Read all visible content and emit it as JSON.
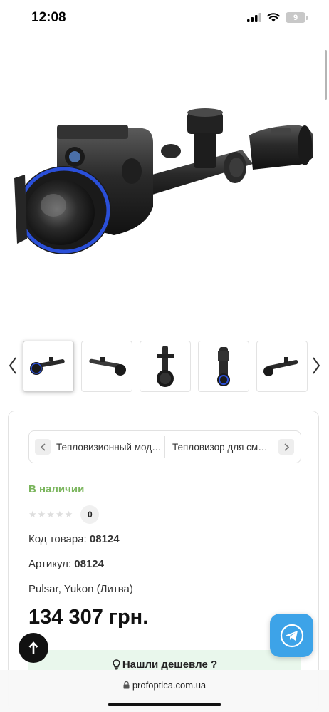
{
  "status": {
    "time": "12:08",
    "battery": "9"
  },
  "gallery": {
    "prev_icon": "chevron-left-icon",
    "next_icon": "chevron-right-icon",
    "thumb_count": 5
  },
  "breadcrumb": {
    "prev_icon": "chevron-left-icon",
    "next_icon": "chevron-right-icon",
    "items": [
      "Тепловизионный модуль",
      "Тепловизор для смартфона"
    ]
  },
  "product": {
    "availability": "В наличии",
    "rating_stars": "★★★★★",
    "rating_count": "0",
    "code_label": "Код товара:",
    "code_value": "08124",
    "article_label": "Артикул:",
    "article_value": "08124",
    "brand": "Pulsar, Yukon (Литва)",
    "price": "134 307 грн.",
    "cheaper_button": "Нашли дешевле ?"
  },
  "browser": {
    "url": "profoptica.com.ua"
  },
  "colors": {
    "availability": "#7ab55c",
    "telegram": "#3da3e8",
    "cheaper_bg": "#e9f7ec",
    "scope_accent": "#2a4fd8"
  }
}
